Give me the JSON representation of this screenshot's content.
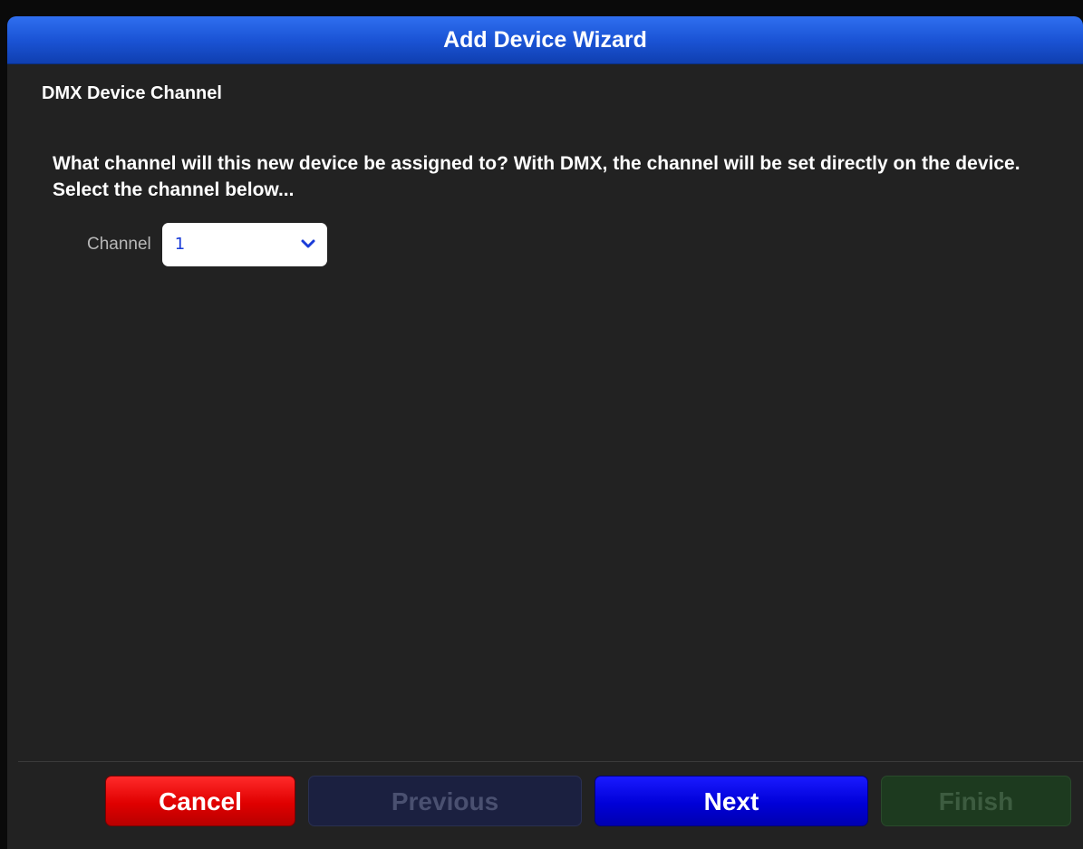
{
  "dialog": {
    "title": "Add Device Wizard"
  },
  "step": {
    "title": "DMX Device Channel",
    "description": "What channel will this new device be assigned to? With DMX, the channel will be set directly on the device. Select the channel below..."
  },
  "channel_field": {
    "label": "Channel",
    "value": "1"
  },
  "buttons": {
    "cancel": "Cancel",
    "previous": "Previous",
    "next": "Next",
    "finish": "Finish"
  },
  "colors": {
    "title_bar": "#1b54d6",
    "cancel": "#e00000",
    "next": "#0000d8",
    "previous_disabled": "#1b2040",
    "finish_disabled": "#1d3a1f"
  },
  "icons": {
    "dropdown": "chevron-down-icon"
  }
}
